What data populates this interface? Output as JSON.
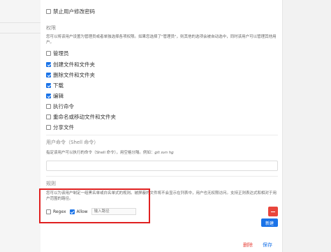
{
  "top_option": {
    "label": "禁止用户修改密码",
    "checked": false
  },
  "permissions": {
    "title": "权限",
    "description": "您可以将该用户设置为管理员或者单独选择各项权限。如果您选择了\"管理员\"，则其他的选项会被自动选中，同时该用户可以管理其他用户。",
    "items": [
      {
        "label": "管理员",
        "checked": false
      },
      {
        "label": "创建文件和文件夹",
        "checked": true
      },
      {
        "label": "删除文件和文件夹",
        "checked": true
      },
      {
        "label": "下载",
        "checked": true
      },
      {
        "label": "编辑",
        "checked": true
      },
      {
        "label": "执行命令",
        "checked": false
      },
      {
        "label": "重命名或移动文件和文件夹",
        "checked": false
      },
      {
        "label": "分享文件",
        "checked": false
      }
    ]
  },
  "commands": {
    "title": "用户命令（Shell 命令）",
    "description_prefix": "指定该用户可以执行的命令（Shell 命令），用空格分隔。例如：",
    "example": "git svn hg",
    "value": ""
  },
  "rules": {
    "title": "规则",
    "description": "您可以为该用户制定一组黑名单或白名单式的规则。被屏蔽的文件将不会显示在列表中，用户也无权限访问。支持正则表达式和相对于用户范围的路径。",
    "regex_label": "Regex",
    "regex_checked": false,
    "allow_label": "Allow",
    "allow_checked": true,
    "path_placeholder": "输入路径",
    "new_label": "新建"
  },
  "footer": {
    "delete_label": "删除",
    "save_label": "保存"
  },
  "colors": {
    "accent": "#1a73e8",
    "danger": "#e8453c",
    "highlight": "#e02020"
  }
}
